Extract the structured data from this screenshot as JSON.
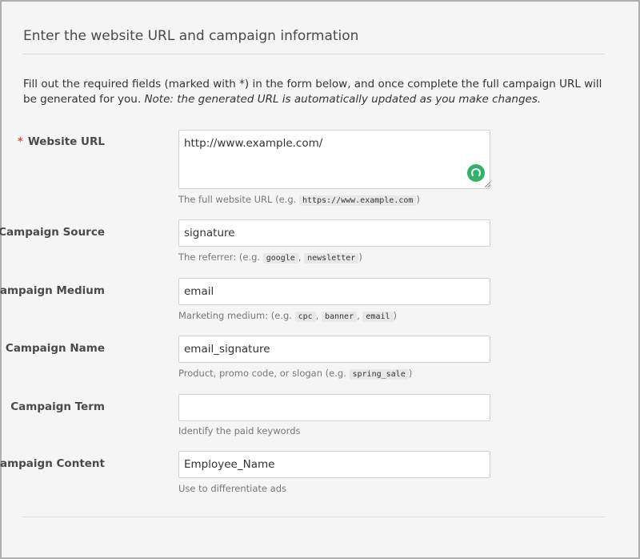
{
  "title": "Enter the website URL and campaign information",
  "intro": {
    "text": "Fill out the required fields (marked with *) in the form below, and once complete the full campaign URL will be generated for you.",
    "note": "Note: the generated URL is automatically updated as you make changes."
  },
  "required_marker": "*",
  "fields": {
    "website_url": {
      "label": "Website URL",
      "value": "http://www.example.com/",
      "help_prefix": "The full website URL (e.g.",
      "help_examples": [
        "https://www.example.com"
      ],
      "help_suffix": ")"
    },
    "campaign_source": {
      "label": "Campaign Source",
      "value": "signature",
      "help_prefix": "The referrer: (e.g.",
      "help_examples": [
        "google",
        "newsletter"
      ],
      "help_suffix": ")"
    },
    "campaign_medium": {
      "label": "Campaign Medium",
      "value": "email",
      "help_prefix": "Marketing medium: (e.g.",
      "help_examples": [
        "cpc",
        "banner",
        "email"
      ],
      "help_suffix": ")"
    },
    "campaign_name": {
      "label": "Campaign Name",
      "value": "email_signature",
      "help_prefix": "Product, promo code, or slogan (e.g.",
      "help_examples": [
        "spring_sale"
      ],
      "help_suffix": ")"
    },
    "campaign_term": {
      "label": "Campaign Term",
      "value": "",
      "help": "Identify the paid keywords"
    },
    "campaign_content": {
      "label": "Campaign Content",
      "value": "Employee_Name",
      "help": "Use to differentiate ads"
    }
  },
  "separator": ",",
  "colors": {
    "required": "#d9534f",
    "status_icon": "#2fb36b",
    "code_bg": "#e8e8e8"
  },
  "icons": {
    "status": "loading-spinner-icon",
    "resize": "resize-grip-icon"
  }
}
